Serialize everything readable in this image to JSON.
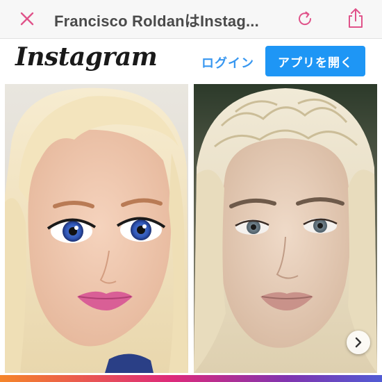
{
  "browser": {
    "title": "Francisco RoldanはInstag...",
    "close_icon": "close-icon",
    "reload_icon": "reload-icon",
    "share_icon": "share-icon"
  },
  "instagram": {
    "logo": "Instagram",
    "login": "ログイン",
    "open_app": "アプリを開く"
  },
  "post": {
    "images": [
      {
        "subject": "doll-before-image"
      },
      {
        "subject": "doll-after-image"
      }
    ],
    "next_icon": "chevron-right-icon"
  },
  "colors": {
    "accent_blue": "#1e96f5",
    "link_blue": "#3897f0",
    "close_pink": "#e0538a"
  }
}
